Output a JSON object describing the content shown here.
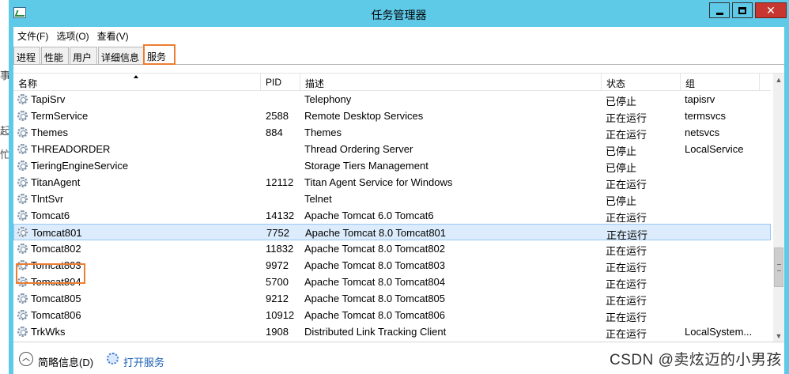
{
  "window": {
    "title": "任务管理器"
  },
  "menu": [
    "文件(F)",
    "选项(O)",
    "查看(V)"
  ],
  "tabs": [
    {
      "label": "进程",
      "active": false
    },
    {
      "label": "性能",
      "active": false
    },
    {
      "label": "用户",
      "active": false
    },
    {
      "label": "详细信息",
      "active": false
    },
    {
      "label": "服务",
      "active": true
    }
  ],
  "columns": [
    "名称",
    "PID",
    "描述",
    "状态",
    "组"
  ],
  "rows": [
    {
      "name": "TapiSrv",
      "pid": "",
      "desc": "Telephony",
      "status": "已停止",
      "group": "tapisrv"
    },
    {
      "name": "TermService",
      "pid": "2588",
      "desc": "Remote Desktop Services",
      "status": "正在运行",
      "group": "termsvcs"
    },
    {
      "name": "Themes",
      "pid": "884",
      "desc": "Themes",
      "status": "正在运行",
      "group": "netsvcs"
    },
    {
      "name": "THREADORDER",
      "pid": "",
      "desc": "Thread Ordering Server",
      "status": "已停止",
      "group": "LocalService"
    },
    {
      "name": "TieringEngineService",
      "pid": "",
      "desc": "Storage Tiers Management",
      "status": "已停止",
      "group": ""
    },
    {
      "name": "TitanAgent",
      "pid": "12112",
      "desc": "Titan Agent Service for Windows",
      "status": "正在运行",
      "group": ""
    },
    {
      "name": "TlntSvr",
      "pid": "",
      "desc": "Telnet",
      "status": "已停止",
      "group": ""
    },
    {
      "name": "Tomcat6",
      "pid": "14132",
      "desc": "Apache Tomcat 6.0 Tomcat6",
      "status": "正在运行",
      "group": ""
    },
    {
      "name": "Tomcat801",
      "pid": "7752",
      "desc": "Apache Tomcat 8.0 Tomcat801",
      "status": "正在运行",
      "group": "",
      "selected": true
    },
    {
      "name": "Tomcat802",
      "pid": "11832",
      "desc": "Apache Tomcat 8.0 Tomcat802",
      "status": "正在运行",
      "group": ""
    },
    {
      "name": "Tomcat803",
      "pid": "9972",
      "desc": "Apache Tomcat 8.0 Tomcat803",
      "status": "正在运行",
      "group": ""
    },
    {
      "name": "Tomcat804",
      "pid": "5700",
      "desc": "Apache Tomcat 8.0 Tomcat804",
      "status": "正在运行",
      "group": ""
    },
    {
      "name": "Tomcat805",
      "pid": "9212",
      "desc": "Apache Tomcat 8.0 Tomcat805",
      "status": "正在运行",
      "group": ""
    },
    {
      "name": "Tomcat806",
      "pid": "10912",
      "desc": "Apache Tomcat 8.0 Tomcat806",
      "status": "正在运行",
      "group": ""
    },
    {
      "name": "TrkWks",
      "pid": "1908",
      "desc": "Distributed Link Tracking Client",
      "status": "正在运行",
      "group": "LocalSystem..."
    }
  ],
  "footer": {
    "less_details": "简略信息(D)",
    "open_services": "打开服务"
  },
  "watermark": "CSDN @卖炫迈的小男孩",
  "colors": {
    "title_bar": "#5fc9e8",
    "highlight": "#ed7d31",
    "selection": "#dcecfc",
    "close_button": "#c7372f"
  }
}
